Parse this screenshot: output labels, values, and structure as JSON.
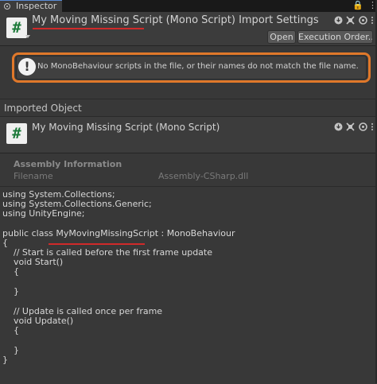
{
  "tab": {
    "label": "Inspector",
    "lock": "🔒",
    "menu": "⋮"
  },
  "header": {
    "icon_glyph": "#",
    "title": "My Moving Missing Script (Mono Script) Import Settings",
    "open_label": "Open",
    "exec_label": "Execution Order..."
  },
  "warning": {
    "icon_glyph": "!",
    "text": "No MonoBehaviour scripts in the file, or their names do not match the file name."
  },
  "imported": {
    "section_label": "Imported Object",
    "icon_glyph": "#",
    "title": "My Moving Missing Script (Mono Script)"
  },
  "assembly": {
    "title": "Assembly Information",
    "filename_label": "Filename",
    "filename_value": "Assembly-CSharp.dll"
  },
  "code": {
    "lines": [
      "using System.Collections;",
      "using System.Collections.Generic;",
      "using UnityEngine;",
      "",
      "public class MyMovingMissingScript : MonoBehaviour",
      "{",
      "    // Start is called before the first frame update",
      "    void Start()",
      "    {",
      "",
      "    }",
      "",
      "    // Update is called once per frame",
      "    void Update()",
      "    {",
      "",
      "    }",
      "}"
    ]
  },
  "colors": {
    "accent_underline": "#d02a2a",
    "warning_outline": "#e0782a"
  }
}
